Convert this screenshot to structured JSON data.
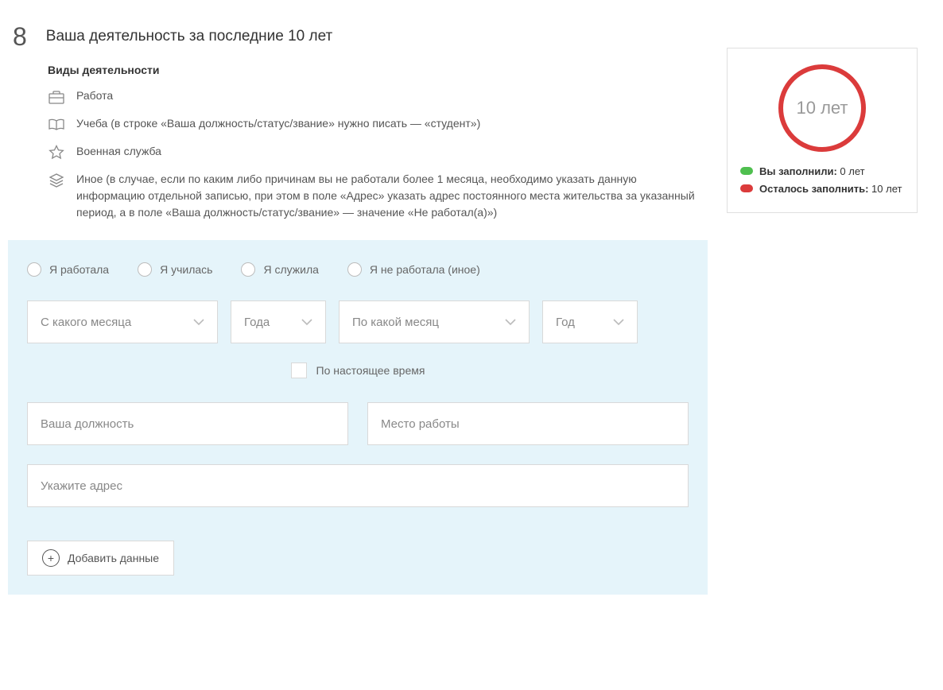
{
  "section": {
    "step": "8",
    "title": "Ваша деятельность за последние 10 лет"
  },
  "activities": {
    "heading": "Виды деятельности",
    "work": "Работа",
    "study": "Учеба (в строке «Ваша должность/статус/звание» нужно писать — «студент»)",
    "military": "Военная служба",
    "other": "Иное (в случае, если по каким либо причинам вы не работали более 1 месяца, необходимо указать данную информацию отдельной записью, при этом в поле «Адрес» указать адрес постоянного места жительства за указанный период, а в поле «Ваша должность/статус/звание» — значение «Не работал(а)»)"
  },
  "form": {
    "radios": {
      "worked": "Я работала",
      "studied": "Я училась",
      "served": "Я служила",
      "none": "Я не работала (иное)"
    },
    "dates": {
      "from_month": "С какого месяца",
      "from_year": "Года",
      "to_month": "По какой месяц",
      "to_year": "Год"
    },
    "present_label": "По настоящее время",
    "position_ph": "Ваша должность",
    "workplace_ph": "Место работы",
    "address_ph": "Укажите адрес",
    "add_btn": "Добавить данные"
  },
  "status": {
    "ring_text": "10 лет",
    "filled_label": "Вы заполнили:",
    "filled_value": "0 лет",
    "remain_label": "Осталось заполнить:",
    "remain_value": "10 лет"
  }
}
